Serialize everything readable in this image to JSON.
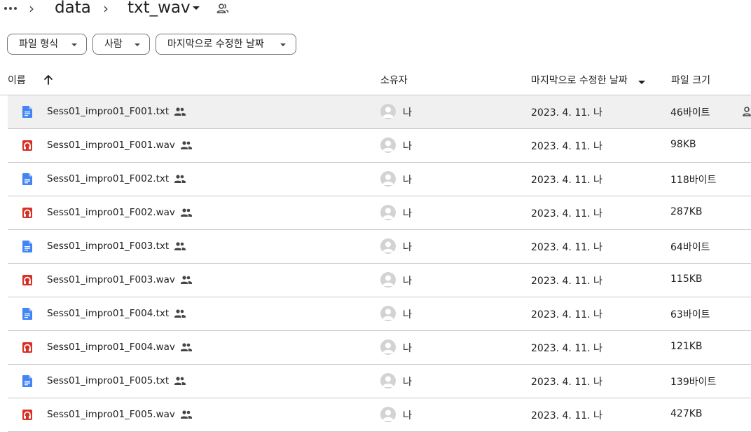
{
  "breadcrumb": {
    "more_label": "…",
    "separator": ">",
    "parent": "data",
    "current": "txt_wav"
  },
  "filters": [
    {
      "label": "파일 형식"
    },
    {
      "label": "사람"
    },
    {
      "label": "마지막으로 수정한 날짜"
    }
  ],
  "columns": {
    "name": "이름",
    "owner": "소유자",
    "modified": "마지막으로 수정한 날짜",
    "size": "파일 크기"
  },
  "colors": {
    "doc_icon": "#4285f4",
    "audio_icon": "#d93025",
    "selected_row": "#f0f0f0",
    "divider": "#c7c7c7"
  },
  "files": [
    {
      "name": "Sess01_impro01_F001.txt",
      "type": "doc",
      "owner": "나",
      "modified": "2023. 4. 11. 나",
      "size": "46바이트"
    },
    {
      "name": "Sess01_impro01_F001.wav",
      "type": "audio",
      "owner": "나",
      "modified": "2023. 4. 11. 나",
      "size": "98KB"
    },
    {
      "name": "Sess01_impro01_F002.txt",
      "type": "doc",
      "owner": "나",
      "modified": "2023. 4. 11. 나",
      "size": "118바이트"
    },
    {
      "name": "Sess01_impro01_F002.wav",
      "type": "audio",
      "owner": "나",
      "modified": "2023. 4. 11. 나",
      "size": "287KB"
    },
    {
      "name": "Sess01_impro01_F003.txt",
      "type": "doc",
      "owner": "나",
      "modified": "2023. 4. 11. 나",
      "size": "64바이트"
    },
    {
      "name": "Sess01_impro01_F003.wav",
      "type": "audio",
      "owner": "나",
      "modified": "2023. 4. 11. 나",
      "size": "115KB"
    },
    {
      "name": "Sess01_impro01_F004.txt",
      "type": "doc",
      "owner": "나",
      "modified": "2023. 4. 11. 나",
      "size": "63바이트"
    },
    {
      "name": "Sess01_impro01_F004.wav",
      "type": "audio",
      "owner": "나",
      "modified": "2023. 4. 11. 나",
      "size": "121KB"
    },
    {
      "name": "Sess01_impro01_F005.txt",
      "type": "doc",
      "owner": "나",
      "modified": "2023. 4. 11. 나",
      "size": "139바이트"
    },
    {
      "name": "Sess01_impro01_F005.wav",
      "type": "audio",
      "owner": "나",
      "modified": "2023. 4. 11. 나",
      "size": "427KB"
    }
  ]
}
